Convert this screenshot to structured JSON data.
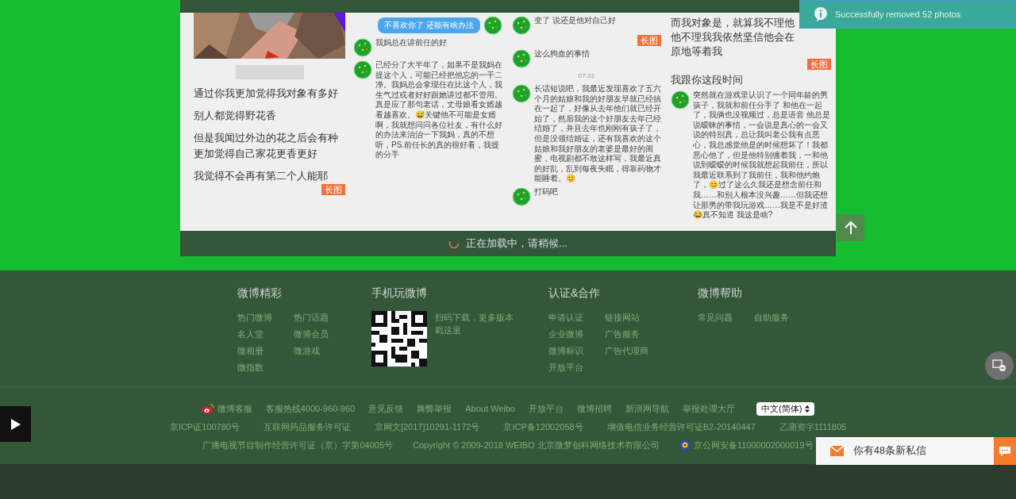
{
  "toast": {
    "text": "Successfully removed 52 photos"
  },
  "posts": [
    {
      "items": [
        {
          "kind": "picture"
        },
        {
          "kind": "blur"
        },
        {
          "kind": "caption",
          "text": "通过你我更加觉得我对象有多好"
        },
        {
          "kind": "caption",
          "text": "别人都觉得野花香"
        },
        {
          "kind": "caption",
          "text": "但是我闻过外边的花之后会有种更加觉得自己家花更香更好"
        },
        {
          "kind": "caption",
          "text": "我觉得不会再有第二个人能耶"
        },
        {
          "kind": "badge",
          "text": "长图"
        }
      ]
    },
    {
      "items": [
        {
          "kind": "sent",
          "text": "不喜欢你了 还能有啥办法"
        },
        {
          "kind": "received",
          "text": "我妈总在讲前任的好"
        },
        {
          "kind": "received",
          "text": "已经分了大半年了，如果不是我妈在提这个人，可能已经把他忘的一干二净。我妈总会拿现任在比这个人，我生气过或者好好跟她讲过都不管用。真是应了那句老话，丈母娘看女婿越看越喜欢。😅关键他不可能是女婿啊，我就想问问各位社友，有什么好的办法来治治一下我妈，真的不想听，PS.前任长的真的很好看，我提的分手"
        }
      ]
    },
    {
      "items": [
        {
          "kind": "received",
          "text": "变了 说还是他对自己好"
        },
        {
          "kind": "badge",
          "text": "长图"
        },
        {
          "kind": "received",
          "text": "这么狗血的事情"
        },
        {
          "kind": "time",
          "text": "07-31"
        },
        {
          "kind": "received",
          "text": "长话短说吧，我最近发现喜欢了五六个月的姑娘和我的好朋友早就已经搞在一起了，好像从去年他们就已经开始了，然后我的这个好朋友去年已经结婚了，并且去年也刚刚有孩子了，但是没领结婚证，还有我喜欢的这个姑娘和我好朋友的老婆是最好的闺蜜，电视剧都不敢这样写，我最近真的好乱，乱到每夜失眠，得靠药物才能睡着。😊"
        },
        {
          "kind": "received",
          "text": "打码吧"
        }
      ]
    },
    {
      "items": [
        {
          "kind": "caption",
          "text": "而我对象是，就算我不理他他不理我我依然坚信他会在原地等着我"
        },
        {
          "kind": "badge",
          "text": "长图"
        },
        {
          "kind": "caption",
          "text": "我跟你这段时间"
        },
        {
          "kind": "received",
          "text": "突然就在游戏里认识了一个同年龄的男孩子，我就和前任分手了 和他在一起了，我俩也没视频过，总是语音 他总是说暧昧的事情，一会说是真心的一会又说的特别真，总让我叫老公我有点恶心，我总感觉他是的时候想坏了！我都恶心他了，但是他特别缠着我，一和他说到暧暧的时候我就想起我前任，所以我最近联系到了我前任，我和他约炮了，😊过了这么久我还是想念前任和我……和别人根本没兴趣……但我还想让那男的带我玩游戏……我是不是好渣😂真不知道 我这是啥?"
        }
      ]
    }
  ],
  "loading": {
    "text": "正在加载中，请稍候..."
  },
  "footer": {
    "sections": [
      {
        "title": "微博精彩",
        "kind": "links",
        "links": [
          "热门微博",
          "热门话题",
          "名人堂",
          "微博会员",
          "微相册",
          "微游戏",
          "微指数"
        ]
      },
      {
        "title": "手机玩微博",
        "kind": "qr",
        "text": "扫码下载，更多版本戳这里"
      },
      {
        "title": "认证&合作",
        "kind": "links",
        "links": [
          "申请认证",
          "链接网站",
          "企业微博",
          "广告服务",
          "微博标识",
          "广告代理商",
          "开放平台"
        ]
      },
      {
        "title": "微博帮助",
        "kind": "links",
        "links": [
          "常见问题",
          "自助服务"
        ]
      }
    ],
    "bottom_links": [
      "微博客服",
      "客服热线4000-960-960",
      "意见反馈",
      "舞弊举报",
      "About Weibo",
      "开放平台",
      "微博招聘",
      "新浪网导航",
      "举报处理大厅"
    ],
    "language": "中文(简体)",
    "licenses": [
      "京ICP证100780号",
      "互联网药品服务许可证",
      "京网文[2017]10291-1172号",
      "京ICP备12002058号",
      "增值电信业务经营许可证B2-20140447",
      "乙测资字1111805"
    ],
    "copyright": [
      "广播电视节目制作经营许可证（京）字第04005号",
      "Copyright © 2009-2018 WEIBO 北京微梦创科网络技术有限公司",
      "京公网安备11000002000019号"
    ]
  },
  "message_bar": {
    "text": "你有48条新私信"
  }
}
